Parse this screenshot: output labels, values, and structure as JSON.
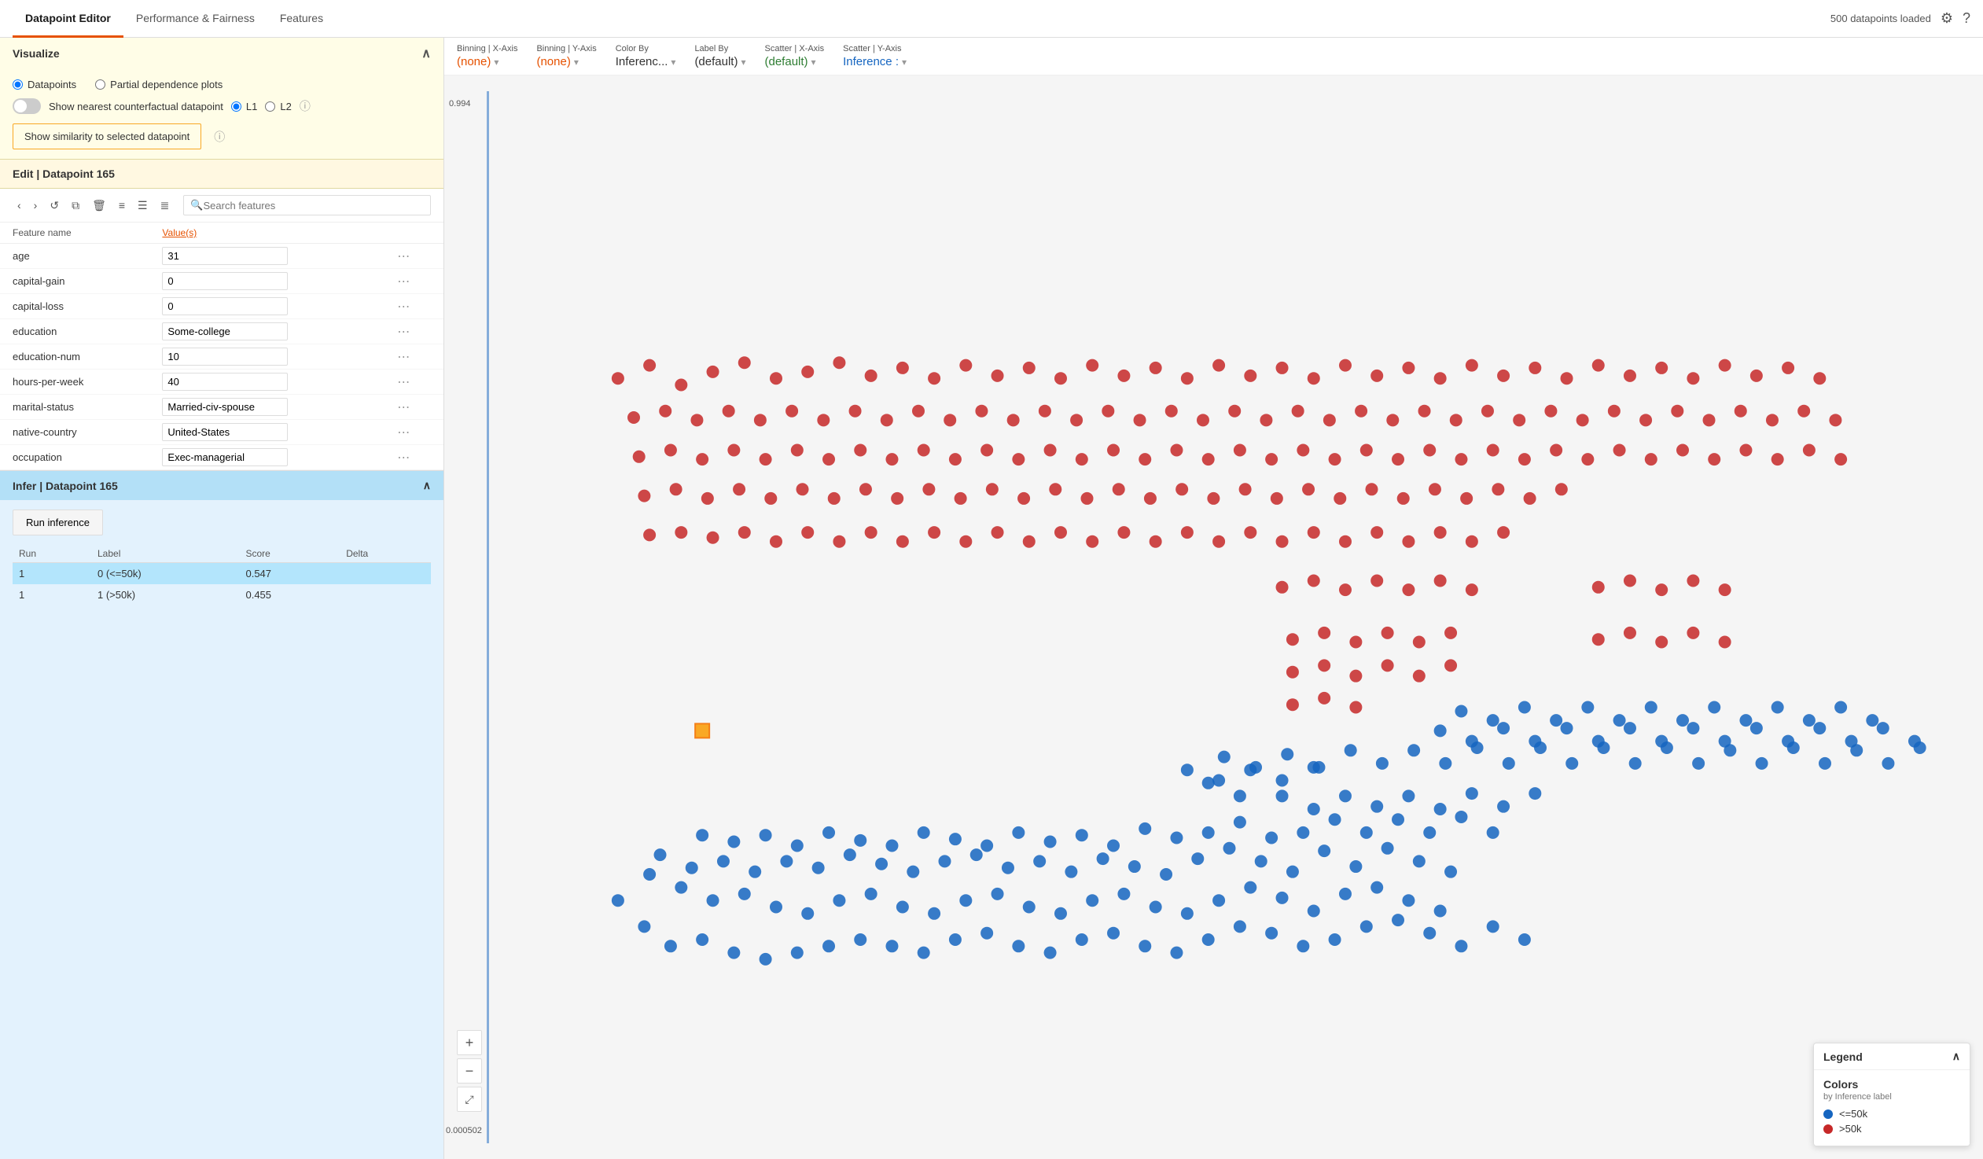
{
  "nav": {
    "tabs": [
      {
        "id": "datapoint-editor",
        "label": "Datapoint Editor",
        "active": true
      },
      {
        "id": "performance-fairness",
        "label": "Performance & Fairness",
        "active": false
      },
      {
        "id": "features",
        "label": "Features",
        "active": false
      }
    ],
    "status": "500 datapoints loaded"
  },
  "visualize": {
    "header": "Visualize",
    "radio_options": [
      {
        "id": "datapoints",
        "label": "Datapoints",
        "checked": true
      },
      {
        "id": "partial-dependence",
        "label": "Partial dependence plots",
        "checked": false
      }
    ],
    "toggle_label": "Show nearest counterfactual datapoint",
    "toggle_on": false,
    "l1_label": "L1",
    "l2_label": "L2",
    "similarity_btn": "Show similarity to selected datapoint"
  },
  "edit": {
    "header": "Edit | Datapoint 165",
    "search_placeholder": "Search features",
    "col_feature": "Feature name",
    "col_values": "Value(s)",
    "features": [
      {
        "name": "age",
        "value": "31"
      },
      {
        "name": "capital-gain",
        "value": "0"
      },
      {
        "name": "capital-loss",
        "value": "0"
      },
      {
        "name": "education",
        "value": "Some-college"
      },
      {
        "name": "education-num",
        "value": "10"
      },
      {
        "name": "hours-per-week",
        "value": "40"
      },
      {
        "name": "marital-status",
        "value": "Married-civ-spouse"
      },
      {
        "name": "native-country",
        "value": "United-States"
      },
      {
        "name": "occupation",
        "value": "Exec-managerial"
      }
    ]
  },
  "infer": {
    "header": "Infer | Datapoint 165",
    "run_btn": "Run inference",
    "col_run": "Run",
    "col_label": "Label",
    "col_score": "Score",
    "col_delta": "Delta",
    "rows": [
      {
        "run": "1",
        "label": "0 (<=50k)",
        "score": "0.547",
        "delta": "",
        "highlighted": true
      },
      {
        "run": "1",
        "label": "1 (>50k)",
        "score": "0.455",
        "delta": "",
        "highlighted": false
      }
    ]
  },
  "controls": {
    "binning_x": {
      "label": "Binning | X-Axis",
      "value": "(none)",
      "color": "orange"
    },
    "binning_y": {
      "label": "Binning | Y-Axis",
      "value": "(none)",
      "color": "orange"
    },
    "color_by": {
      "label": "Color By",
      "value": "Inferenc...",
      "color": "default"
    },
    "label_by": {
      "label": "Label By",
      "value": "(default)",
      "color": "default"
    },
    "scatter_x": {
      "label": "Scatter | X-Axis",
      "value": "(default)",
      "color": "green"
    },
    "scatter_y": {
      "label": "Scatter | Y-Axis",
      "value": "Inference :",
      "color": "blue"
    }
  },
  "legend": {
    "title": "Legend",
    "section_title": "Colors",
    "subtitle": "by Inference label",
    "items": [
      {
        "label": "<=50k",
        "color": "#1565c0"
      },
      {
        "label": ">50k",
        "color": "#c62828"
      }
    ]
  },
  "scatter": {
    "y_top": "0.994",
    "y_bottom": "0.000502",
    "blue_dots": [
      [
        120,
        620
      ],
      [
        145,
        640
      ],
      [
        170,
        655
      ],
      [
        200,
        650
      ],
      [
        230,
        660
      ],
      [
        260,
        665
      ],
      [
        290,
        660
      ],
      [
        320,
        655
      ],
      [
        350,
        650
      ],
      [
        380,
        655
      ],
      [
        410,
        660
      ],
      [
        440,
        650
      ],
      [
        470,
        645
      ],
      [
        500,
        655
      ],
      [
        530,
        660
      ],
      [
        560,
        650
      ],
      [
        590,
        645
      ],
      [
        620,
        655
      ],
      [
        650,
        660
      ],
      [
        680,
        650
      ],
      [
        710,
        640
      ],
      [
        740,
        645
      ],
      [
        770,
        655
      ],
      [
        800,
        650
      ],
      [
        830,
        640
      ],
      [
        860,
        635
      ],
      [
        890,
        645
      ],
      [
        920,
        655
      ],
      [
        950,
        640
      ],
      [
        980,
        650
      ],
      [
        150,
        600
      ],
      [
        180,
        610
      ],
      [
        210,
        620
      ],
      [
        240,
        615
      ],
      [
        270,
        625
      ],
      [
        300,
        630
      ],
      [
        330,
        620
      ],
      [
        360,
        615
      ],
      [
        390,
        625
      ],
      [
        420,
        630
      ],
      [
        450,
        620
      ],
      [
        480,
        615
      ],
      [
        510,
        625
      ],
      [
        540,
        630
      ],
      [
        570,
        620
      ],
      [
        600,
        615
      ],
      [
        630,
        625
      ],
      [
        660,
        630
      ],
      [
        690,
        620
      ],
      [
        720,
        610
      ],
      [
        750,
        618
      ],
      [
        780,
        628
      ],
      [
        810,
        615
      ],
      [
        840,
        610
      ],
      [
        870,
        620
      ],
      [
        900,
        628
      ],
      [
        160,
        585
      ],
      [
        190,
        595
      ],
      [
        220,
        590
      ],
      [
        250,
        598
      ],
      [
        280,
        590
      ],
      [
        310,
        595
      ],
      [
        340,
        585
      ],
      [
        370,
        592
      ],
      [
        400,
        598
      ],
      [
        430,
        590
      ],
      [
        460,
        585
      ],
      [
        490,
        595
      ],
      [
        520,
        590
      ],
      [
        550,
        598
      ],
      [
        580,
        588
      ],
      [
        610,
        594
      ],
      [
        640,
        600
      ],
      [
        670,
        588
      ],
      [
        700,
        580
      ],
      [
        730,
        590
      ],
      [
        760,
        598
      ],
      [
        790,
        582
      ],
      [
        820,
        594
      ],
      [
        850,
        580
      ],
      [
        880,
        590
      ],
      [
        910,
        598
      ],
      [
        200,
        570
      ],
      [
        230,
        575
      ],
      [
        260,
        570
      ],
      [
        290,
        578
      ],
      [
        320,
        568
      ],
      [
        350,
        574
      ],
      [
        380,
        578
      ],
      [
        410,
        568
      ],
      [
        440,
        573
      ],
      [
        470,
        578
      ],
      [
        500,
        568
      ],
      [
        530,
        575
      ],
      [
        560,
        570
      ],
      [
        590,
        578
      ],
      [
        620,
        565
      ],
      [
        650,
        572
      ],
      [
        680,
        568
      ],
      [
        710,
        560
      ],
      [
        740,
        572
      ],
      [
        770,
        568
      ],
      [
        800,
        558
      ],
      [
        830,
        568
      ],
      [
        860,
        558
      ],
      [
        890,
        568
      ],
      [
        920,
        556
      ],
      [
        950,
        568
      ],
      [
        750,
        540
      ],
      [
        780,
        550
      ],
      [
        810,
        540
      ],
      [
        840,
        548
      ],
      [
        870,
        540
      ],
      [
        900,
        550
      ],
      [
        930,
        538
      ],
      [
        960,
        548
      ],
      [
        990,
        538
      ],
      [
        680,
        530
      ],
      [
        710,
        540
      ],
      [
        660,
        520
      ],
      [
        690,
        528
      ],
      [
        720,
        520
      ],
      [
        750,
        528
      ],
      [
        780,
        518
      ],
      [
        695,
        510
      ],
      [
        725,
        518
      ],
      [
        755,
        508
      ],
      [
        785,
        518
      ],
      [
        815,
        505
      ],
      [
        845,
        515
      ],
      [
        875,
        505
      ],
      [
        905,
        515
      ],
      [
        935,
        503
      ],
      [
        965,
        515
      ],
      [
        995,
        503
      ],
      [
        1025,
        515
      ],
      [
        1055,
        503
      ],
      [
        1085,
        515
      ],
      [
        1115,
        503
      ],
      [
        1145,
        515
      ],
      [
        1175,
        505
      ],
      [
        1205,
        515
      ],
      [
        1235,
        503
      ],
      [
        1265,
        515
      ],
      [
        1295,
        505
      ],
      [
        1325,
        515
      ],
      [
        1355,
        503
      ],
      [
        900,
        490
      ],
      [
        930,
        498
      ],
      [
        960,
        488
      ],
      [
        990,
        498
      ],
      [
        1020,
        488
      ],
      [
        1050,
        498
      ],
      [
        1080,
        488
      ],
      [
        1110,
        498
      ],
      [
        1140,
        488
      ],
      [
        1170,
        498
      ],
      [
        1200,
        488
      ],
      [
        1230,
        498
      ],
      [
        1260,
        488
      ],
      [
        1290,
        498
      ],
      [
        1320,
        488
      ],
      [
        1350,
        498
      ],
      [
        920,
        475
      ],
      [
        950,
        482
      ],
      [
        980,
        472
      ],
      [
        1010,
        482
      ],
      [
        1040,
        472
      ],
      [
        1070,
        482
      ],
      [
        1100,
        472
      ],
      [
        1130,
        482
      ],
      [
        1160,
        472
      ],
      [
        1190,
        482
      ],
      [
        1220,
        472
      ],
      [
        1250,
        482
      ],
      [
        1280,
        472
      ],
      [
        1310,
        482
      ]
    ],
    "red_dots": [
      [
        120,
        220
      ],
      [
        150,
        210
      ],
      [
        180,
        225
      ],
      [
        210,
        215
      ],
      [
        240,
        208
      ],
      [
        270,
        220
      ],
      [
        300,
        215
      ],
      [
        330,
        208
      ],
      [
        360,
        218
      ],
      [
        390,
        212
      ],
      [
        420,
        220
      ],
      [
        450,
        210
      ],
      [
        480,
        218
      ],
      [
        510,
        212
      ],
      [
        540,
        220
      ],
      [
        570,
        210
      ],
      [
        600,
        218
      ],
      [
        630,
        212
      ],
      [
        660,
        220
      ],
      [
        690,
        210
      ],
      [
        720,
        218
      ],
      [
        750,
        212
      ],
      [
        780,
        220
      ],
      [
        810,
        210
      ],
      [
        840,
        218
      ],
      [
        870,
        212
      ],
      [
        900,
        220
      ],
      [
        930,
        210
      ],
      [
        960,
        218
      ],
      [
        990,
        212
      ],
      [
        1020,
        220
      ],
      [
        1050,
        210
      ],
      [
        1080,
        218
      ],
      [
        1110,
        212
      ],
      [
        1140,
        220
      ],
      [
        1170,
        210
      ],
      [
        1200,
        218
      ],
      [
        1230,
        212
      ],
      [
        1260,
        220
      ],
      [
        135,
        250
      ],
      [
        165,
        245
      ],
      [
        195,
        252
      ],
      [
        225,
        245
      ],
      [
        255,
        252
      ],
      [
        285,
        245
      ],
      [
        315,
        252
      ],
      [
        345,
        245
      ],
      [
        375,
        252
      ],
      [
        405,
        245
      ],
      [
        435,
        252
      ],
      [
        465,
        245
      ],
      [
        495,
        252
      ],
      [
        525,
        245
      ],
      [
        555,
        252
      ],
      [
        585,
        245
      ],
      [
        615,
        252
      ],
      [
        645,
        245
      ],
      [
        675,
        252
      ],
      [
        705,
        245
      ],
      [
        735,
        252
      ],
      [
        765,
        245
      ],
      [
        795,
        252
      ],
      [
        825,
        245
      ],
      [
        855,
        252
      ],
      [
        885,
        245
      ],
      [
        915,
        252
      ],
      [
        945,
        245
      ],
      [
        975,
        252
      ],
      [
        1005,
        245
      ],
      [
        1035,
        252
      ],
      [
        1065,
        245
      ],
      [
        1095,
        252
      ],
      [
        1125,
        245
      ],
      [
        1155,
        252
      ],
      [
        1185,
        245
      ],
      [
        1215,
        252
      ],
      [
        1245,
        245
      ],
      [
        1275,
        252
      ],
      [
        140,
        280
      ],
      [
        170,
        275
      ],
      [
        200,
        282
      ],
      [
        230,
        275
      ],
      [
        260,
        282
      ],
      [
        290,
        275
      ],
      [
        320,
        282
      ],
      [
        350,
        275
      ],
      [
        380,
        282
      ],
      [
        410,
        275
      ],
      [
        440,
        282
      ],
      [
        470,
        275
      ],
      [
        500,
        282
      ],
      [
        530,
        275
      ],
      [
        560,
        282
      ],
      [
        590,
        275
      ],
      [
        620,
        282
      ],
      [
        650,
        275
      ],
      [
        680,
        282
      ],
      [
        710,
        275
      ],
      [
        740,
        282
      ],
      [
        770,
        275
      ],
      [
        800,
        282
      ],
      [
        830,
        275
      ],
      [
        860,
        282
      ],
      [
        890,
        275
      ],
      [
        920,
        282
      ],
      [
        950,
        275
      ],
      [
        980,
        282
      ],
      [
        1010,
        275
      ],
      [
        1040,
        282
      ],
      [
        1070,
        275
      ],
      [
        1100,
        282
      ],
      [
        1130,
        275
      ],
      [
        1160,
        282
      ],
      [
        1190,
        275
      ],
      [
        1220,
        282
      ],
      [
        1250,
        275
      ],
      [
        1280,
        282
      ],
      [
        145,
        310
      ],
      [
        175,
        305
      ],
      [
        205,
        312
      ],
      [
        235,
        305
      ],
      [
        265,
        312
      ],
      [
        295,
        305
      ],
      [
        325,
        312
      ],
      [
        355,
        305
      ],
      [
        385,
        312
      ],
      [
        415,
        305
      ],
      [
        445,
        312
      ],
      [
        475,
        305
      ],
      [
        505,
        312
      ],
      [
        535,
        305
      ],
      [
        565,
        312
      ],
      [
        595,
        305
      ],
      [
        625,
        312
      ],
      [
        655,
        305
      ],
      [
        685,
        312
      ],
      [
        715,
        305
      ],
      [
        745,
        312
      ],
      [
        775,
        305
      ],
      [
        805,
        312
      ],
      [
        835,
        305
      ],
      [
        865,
        312
      ],
      [
        895,
        305
      ],
      [
        925,
        312
      ],
      [
        955,
        305
      ],
      [
        985,
        312
      ],
      [
        1015,
        305
      ],
      [
        150,
        340
      ],
      [
        180,
        338
      ],
      [
        210,
        342
      ],
      [
        240,
        338
      ],
      [
        270,
        345
      ],
      [
        300,
        338
      ],
      [
        330,
        345
      ],
      [
        360,
        338
      ],
      [
        390,
        345
      ],
      [
        420,
        338
      ],
      [
        450,
        345
      ],
      [
        480,
        338
      ],
      [
        510,
        345
      ],
      [
        540,
        338
      ],
      [
        570,
        345
      ],
      [
        600,
        338
      ],
      [
        630,
        345
      ],
      [
        660,
        338
      ],
      [
        690,
        345
      ],
      [
        720,
        338
      ],
      [
        750,
        345
      ],
      [
        780,
        338
      ],
      [
        810,
        345
      ],
      [
        840,
        338
      ],
      [
        870,
        345
      ],
      [
        900,
        338
      ],
      [
        930,
        345
      ],
      [
        960,
        338
      ],
      [
        750,
        380
      ],
      [
        780,
        375
      ],
      [
        810,
        382
      ],
      [
        840,
        375
      ],
      [
        870,
        382
      ],
      [
        900,
        375
      ],
      [
        930,
        382
      ],
      [
        760,
        420
      ],
      [
        790,
        415
      ],
      [
        820,
        422
      ],
      [
        850,
        415
      ],
      [
        880,
        422
      ],
      [
        910,
        415
      ],
      [
        760,
        445
      ],
      [
        790,
        440
      ],
      [
        820,
        448
      ],
      [
        850,
        440
      ],
      [
        880,
        448
      ],
      [
        910,
        440
      ],
      [
        760,
        470
      ],
      [
        790,
        465
      ],
      [
        820,
        472
      ],
      [
        1050,
        380
      ],
      [
        1080,
        375
      ],
      [
        1110,
        382
      ],
      [
        1140,
        375
      ],
      [
        1170,
        382
      ],
      [
        1050,
        420
      ],
      [
        1080,
        415
      ],
      [
        1110,
        422
      ],
      [
        1140,
        415
      ],
      [
        1170,
        422
      ]
    ]
  }
}
